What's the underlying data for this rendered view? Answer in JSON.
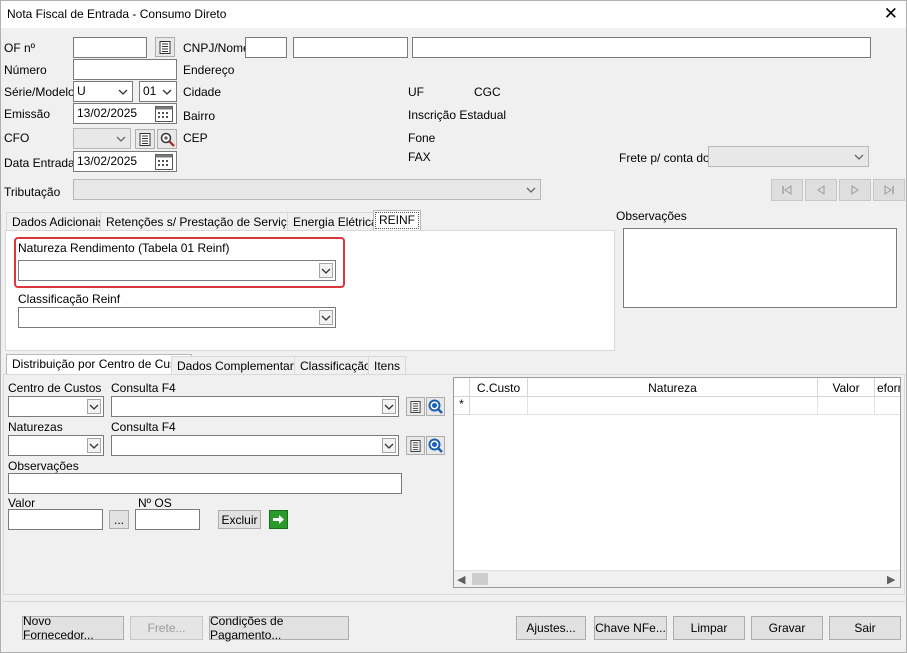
{
  "window": {
    "title": "Nota Fiscal de Entrada - Consumo Direto"
  },
  "form": {
    "of_label": "OF nº",
    "numero_label": "Número",
    "serie_label": "Série/Modelo",
    "serie_value": "U",
    "modelo_value": "01",
    "emissao_label": "Emissão",
    "emissao_value": "13/02/2025",
    "cfo_label": "CFO",
    "data_entrada_label": "Data Entrada",
    "data_entrada_value": "13/02/2025",
    "tributacao_label": "Tributação",
    "cnpj_label": "CNPJ/Nome",
    "endereco_label": "Endereço",
    "cidade_label": "Cidade",
    "bairro_label": "Bairro",
    "cep_label": "CEP",
    "uf_label": "UF",
    "cgc_label": "CGC",
    "inscricao_label": "Inscrição Estadual",
    "fone_label": "Fone",
    "fax_label": "FAX",
    "frete_label": "Frete p/ conta do",
    "observacoes_label": "Observações"
  },
  "top_tabs": [
    "Dados Adicionais",
    "Retenções s/ Prestação de Serviços",
    "Energia Elétrica",
    "REINF"
  ],
  "reinf": {
    "natureza_label": "Natureza Rendimento (Tabela 01 Reinf)",
    "classificacao_label": "Classificação Reinf"
  },
  "bottom_tabs": [
    "Distribuição por Centro de Custo",
    "Dados Complementares",
    "Classificação",
    "Itens"
  ],
  "distribuicao": {
    "centro_label": "Centro de Custos",
    "consulta1_label": "Consulta F4",
    "naturezas_label": "Naturezas",
    "consulta2_label": "Consulta F4",
    "obs_label": "Observações",
    "valor_label": "Valor",
    "nos_label": "Nº OS",
    "ellipsis_label": "...",
    "excluir_label": "Excluir"
  },
  "grid": {
    "columns": [
      "C.Custo",
      "Natureza",
      "Valor",
      "eform"
    ],
    "new_row_marker": "*"
  },
  "buttons": {
    "novo_fornecedor": "Novo Fornecedor...",
    "frete": "Frete...",
    "condicoes": "Condições de Pagamento...",
    "ajustes": "Ajustes...",
    "chave_nfe": "Chave NFe...",
    "limpar": "Limpar",
    "gravar": "Gravar",
    "sair": "Sair"
  },
  "colors": {
    "highlight": "#d9363e",
    "go_green": "#2a9a2a",
    "lookup_blue": "#1a5fb4"
  }
}
